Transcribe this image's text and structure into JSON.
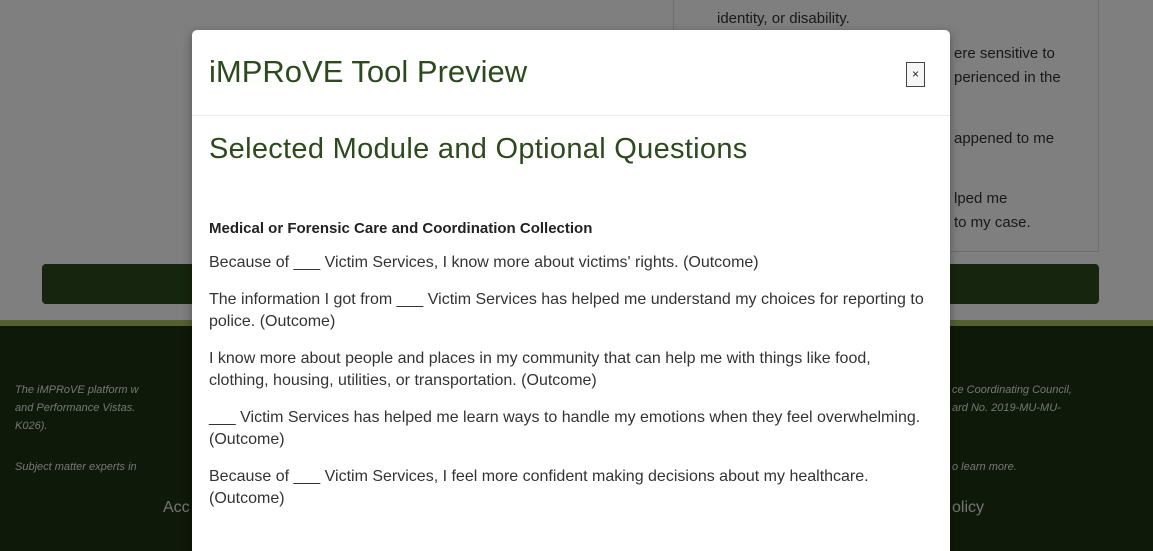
{
  "background": {
    "card_lines": [
      "identity, or disability.",
      "ere sensitive to",
      "perienced in the",
      "appened to me",
      "lped me",
      "to my case."
    ],
    "footer_lines": [
      "The iMPRoVE platform w",
      "and Performance Vistas.",
      "K026).",
      "Subject matter experts in"
    ],
    "footer_right_lines": [
      "ce Coordinating Council,",
      "ard No. 2019-MU-MU-",
      "o learn more."
    ],
    "footer_links": [
      "Acc",
      "olicy"
    ]
  },
  "modal": {
    "title": "iMPRoVE Tool Preview",
    "close_label": "×",
    "section_title": "Selected Module and Optional Questions",
    "module_title": "Medical or Forensic Care and Coordination Collection",
    "questions": [
      "Because of ___ Victim Services, I know more about victims' rights. (Outcome)",
      "The information I got from ___ Victim Services has helped me understand my choices for reporting to police. (Outcome)",
      "I know more about people and places in my community that can help me with things like food, clothing, housing, utilities, or transportation. (Outcome)",
      "___ Victim Services has helped me learn ways to handle my emotions when they feel overwhelming. (Outcome)",
      "Because of ___ Victim Services, I feel more confident making decisions about my healthcare. (Outcome)"
    ]
  }
}
